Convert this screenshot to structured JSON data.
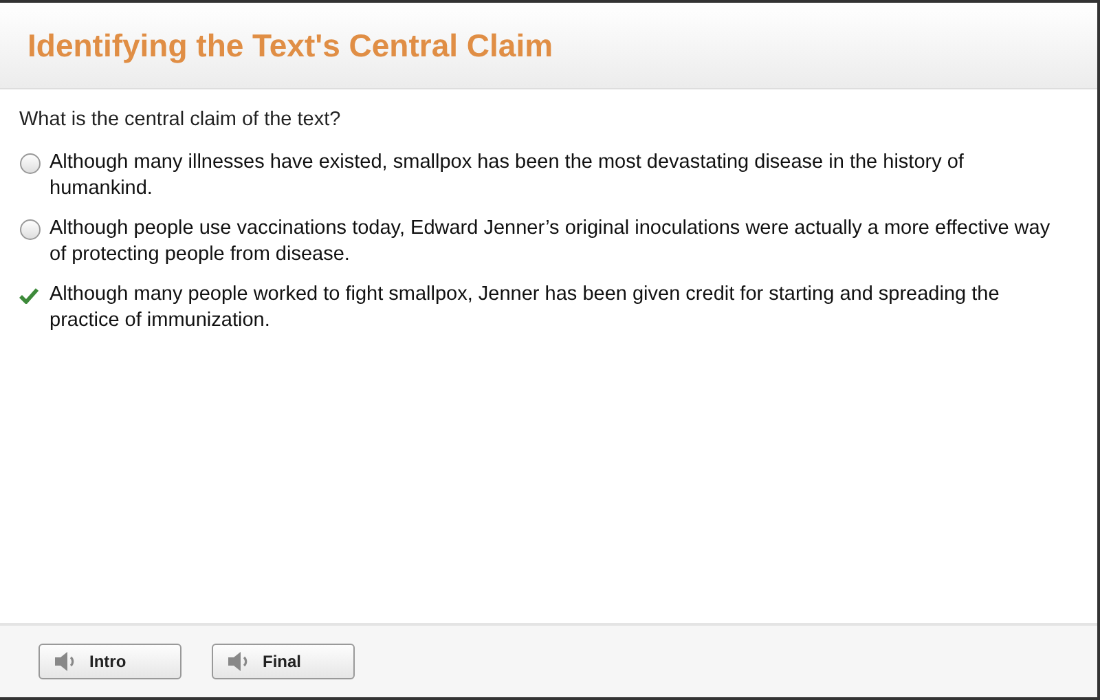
{
  "title": "Identifying the Text's Central Claim",
  "question": "What is the central claim of the text?",
  "options": [
    {
      "text": "Although many illnesses have existed, smallpox has been the most devastating disease in the history of humankind.",
      "selected": false
    },
    {
      "text": "Although people use vaccinations today, Edward Jenner’s original inoculations were actually a more effective way of protecting people from disease.",
      "selected": false
    },
    {
      "text": "Although many people worked to fight smallpox, Jenner has been given credit for starting and spreading the practice of immunization.",
      "selected": true
    }
  ],
  "buttons": [
    "Intro",
    "Final"
  ]
}
